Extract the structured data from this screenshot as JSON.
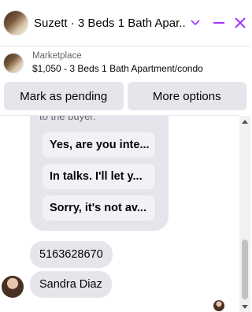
{
  "header": {
    "title": "Suzett · 3 Beds 1 Bath Apar...",
    "avatar_icon": "apartment-photo-icon",
    "chevron_icon": "chevron-down-icon",
    "minimize_icon": "minimize-icon",
    "close_icon": "close-icon",
    "accent_color": "#a033ff"
  },
  "listing": {
    "source": "Marketplace",
    "description": "$1,050 - 3 Beds 1 Bath Apartment/condo"
  },
  "actions": {
    "mark_pending_label": "Mark as pending",
    "more_options_label": "More options"
  },
  "messages": {
    "card_text": "to the buyer.",
    "quick_replies": [
      "Yes, are you inte...",
      "In talks. I'll let y...",
      "Sorry, it's not av..."
    ],
    "bubbles": [
      "5163628670",
      "Sandra Diaz"
    ]
  },
  "colors": {
    "bubble_bg": "#e4e6eb",
    "chip_bg": "#f0f2f5",
    "secondary_text": "#65676b"
  }
}
